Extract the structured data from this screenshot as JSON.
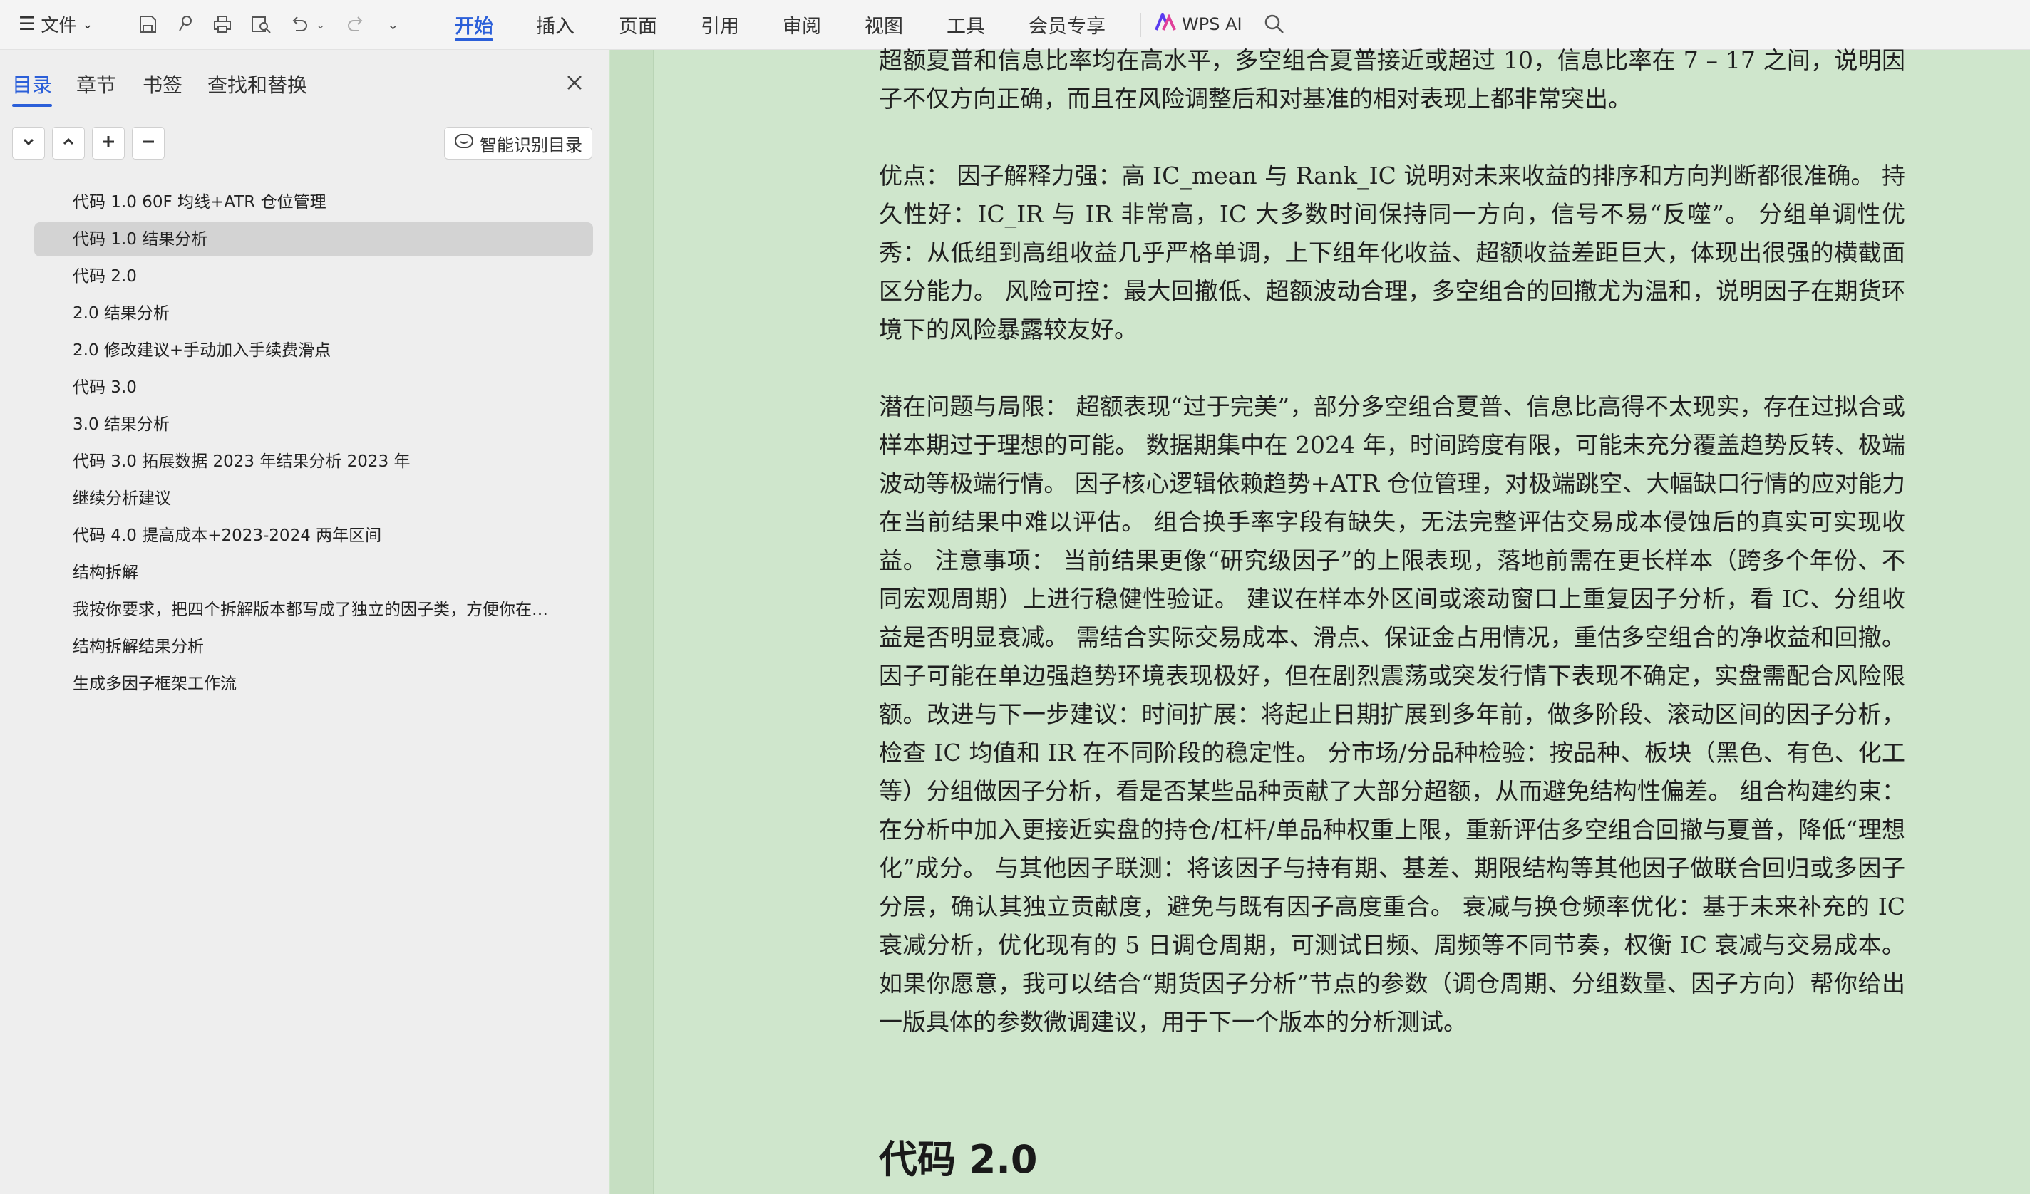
{
  "toolbar": {
    "file_menu": "文件",
    "tabs": [
      "开始",
      "插入",
      "页面",
      "引用",
      "审阅",
      "视图",
      "工具",
      "会员专享"
    ],
    "active_tab": "开始",
    "wps_ai": "WPS AI",
    "accent_color": "#2b5fd9"
  },
  "sidebar": {
    "tabs": [
      "目录",
      "章节",
      "书签",
      "查找和替换"
    ],
    "active_tab": "目录",
    "smart_toc_button": "智能识别目录",
    "toc_items": [
      "代码 1.0 60F 均线+ATR 仓位管理",
      "代码 1.0 结果分析",
      "代码 2.0",
      "2.0 结果分析",
      "2.0 修改建议+手动加入手续费滑点",
      "代码 3.0",
      "3.0 结果分析",
      "代码 3.0 拓展数据 2023 年结果分析 2023 年",
      "继续分析建议",
      "代码 4.0  提高成本+2023-2024 两年区间",
      "结构拆解",
      "我按你要求，把四个拆解版本都写成了独立的因子类，方便你在…",
      "结构拆解结果分析",
      "生成多因子框架工作流"
    ],
    "selected_item": "代码 1.0 结果分析"
  },
  "document": {
    "paragraphs": [
      "超额夏普和信息比率均在高水平，多空组合夏普接近或超过 10，信息比率在 7 – 17 之间，说明因子不仅方向正确，而且在风险调整后和对基准的相对表现上都非常突出。",
      "优点： 因子解释力强：高 IC_mean 与 Rank_IC 说明对未来收益的排序和方向判断都很准确。 持久性好：IC_IR 与 IR 非常高，IC 大多数时间保持同一方向，信号不易“反噬”。 分组单调性优秀：从低组到高组收益几乎严格单调，上下组年化收益、超额收益差距巨大，体现出很强的横截面区分能力。 风险可控：最大回撤低、超额波动合理，多空组合的回撤尤为温和，说明因子在期货环境下的风险暴露较友好。",
      "潜在问题与局限： 超额表现“过于完美”，部分多空组合夏普、信息比高得不太现实，存在过拟合或样本期过于理想的可能。 数据期集中在 2024 年，时间跨度有限，可能未充分覆盖趋势反转、极端波动等极端行情。 因子核心逻辑依赖趋势+ATR 仓位管理，对极端跳空、大幅缺口行情的应对能力在当前结果中难以评估。 组合换手率字段有缺失，无法完整评估交易成本侵蚀后的真实可实现收益。 注意事项： 当前结果更像“研究级因子”的上限表现，落地前需在更长样本（跨多个年份、不同宏观周期）上进行稳健性验证。 建议在样本外区间或滚动窗口上重复因子分析，看 IC、分组收益是否明显衰减。 需结合实际交易成本、滑点、保证金占用情况，重估多空组合的净收益和回撤。 因子可能在单边强趋势环境表现极好，但在剧烈震荡或突发行情下表现不确定，实盘需配合风险限额。改进与下一步建议：时间扩展：将起止日期扩展到多年前，做多阶段、滚动区间的因子分析，检查 IC 均值和 IR 在不同阶段的稳定性。 分市场/分品种检验：按品种、板块（黑色、有色、化工等）分组做因子分析，看是否某些品种贡献了大部分超额，从而避免结构性偏差。 组合构建约束：在分析中加入更接近实盘的持仓/杠杆/单品种权重上限，重新评估多空组合回撤与夏普，降低“理想化”成分。 与其他因子联测：将该因子与持有期、基差、期限结构等其他因子做联合回归或多因子分层，确认其独立贡献度，避免与既有因子高度重合。 衰减与换仓频率优化：基于未来补充的 IC 衰减分析，优化现有的 5 日调仓周期，可测试日频、周频等不同节奏，权衡 IC 衰减与交易成本。 如果你愿意，我可以结合“期货因子分析”节点的参数（调仓周期、分组数量、因子方向）帮你给出一版具体的参数微调建议，用于下一个版本的分析测试。"
    ],
    "heading": "代码 2.0",
    "page_color": "#cfe6cc"
  }
}
